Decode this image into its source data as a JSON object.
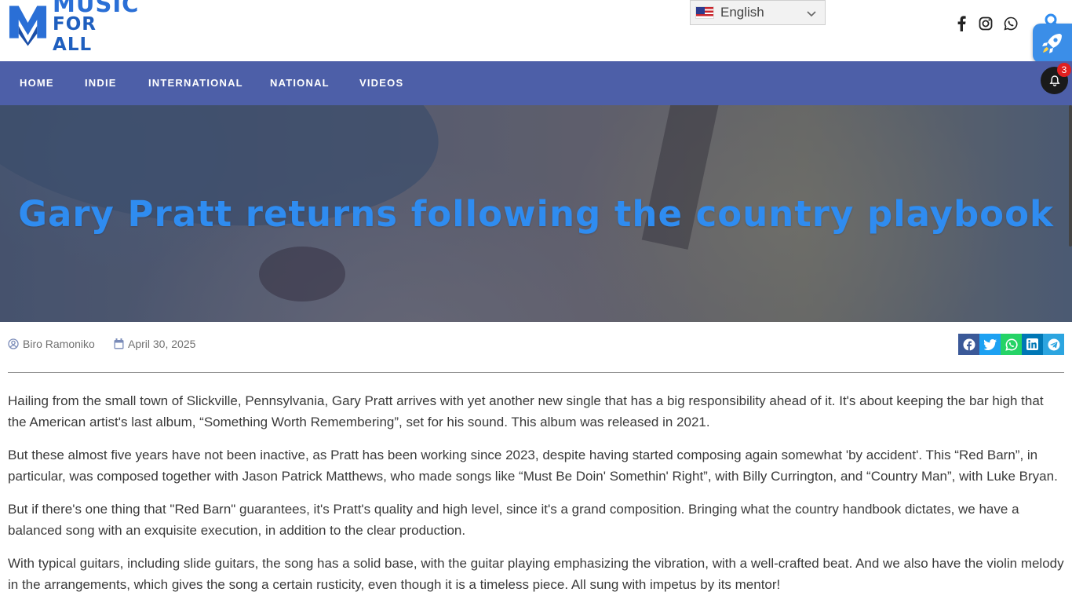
{
  "site": {
    "logo_line1": "MUSIC",
    "logo_line2": "FOR ALL",
    "brand_color": "#2a6fd6"
  },
  "language": {
    "label": "English",
    "flag": "us-flag-icon"
  },
  "header_social": [
    "facebook-icon",
    "instagram-icon",
    "whatsapp-icon",
    "search-icon"
  ],
  "nav": {
    "items": [
      "HOME",
      "INDIE",
      "INTERNATIONAL",
      "NATIONAL",
      "VIDEOS"
    ],
    "background": "#4d5fa8",
    "notification_count": "3"
  },
  "hero": {
    "title": "Gary Pratt returns following the country playbook",
    "title_color": "#2f8cf0"
  },
  "meta": {
    "author": "Biro Ramoniko",
    "date": "April 30, 2025"
  },
  "share_buttons": [
    {
      "icon": "facebook-icon",
      "color": "#3b5998"
    },
    {
      "icon": "twitter-icon",
      "color": "#1da1f2"
    },
    {
      "icon": "whatsapp-icon",
      "color": "#25d366"
    },
    {
      "icon": "linkedin-icon",
      "color": "#0077b5"
    },
    {
      "icon": "telegram-icon",
      "color": "#2ca5e0"
    }
  ],
  "article": {
    "paragraphs": [
      "Hailing from the small town of Slickville, Pennsylvania, Gary Pratt arrives with yet another new single that has a big responsibility ahead of it. It's about keeping the bar high that the American artist's last album, “Something Worth Remembering”, set for his sound. This album was released in 2021.",
      "But these almost five years have not been inactive, as Pratt has been working since 2023, despite having started composing again somewhat 'by accident'. This “Red Barn”, in particular, was composed together with Jason Patrick Matthews, who made songs like “Must Be Doin' Somethin' Right”, with Billy Currington, and “Country Man”, with Luke Bryan.",
      "But if there's one thing that \"Red Barn\" guarantees, it's Pratt's quality and high level, since it's a grand composition. Bringing what the country handbook dictates, we have a balanced song with an exquisite execution, in addition to the clear production.",
      "With typical guitars, including slide guitars, the song has a solid base, with the guitar playing emphasizing the vibration, with a well-crafted beat. And we also have the violin melody in the arrangements, which gives the song a certain rusticity, even though it is a timeless piece. All sung with impetus by its mentor!"
    ]
  }
}
